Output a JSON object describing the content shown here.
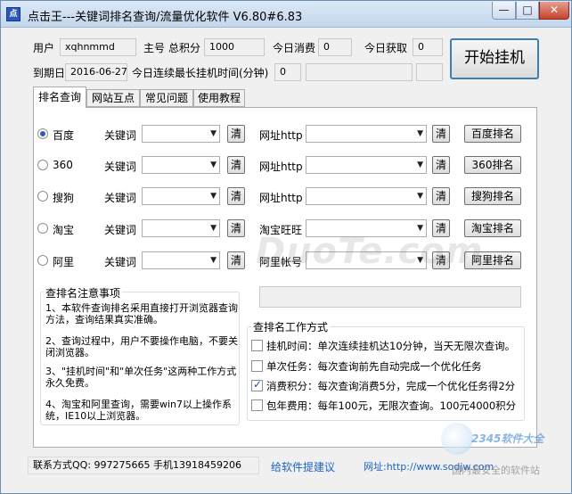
{
  "window": {
    "title": "点击王---关键词排名查询/流量优化软件  V6.80#6.83",
    "icon": "app-icon",
    "controls": {
      "minimize": "—",
      "maximize": "□",
      "close": "✕"
    }
  },
  "account": {
    "user_label": "用户",
    "user_value": "xqhnmmd",
    "main_label": "主号",
    "points_label": "总积分",
    "points_value": "1000",
    "today_spend_label": "今日消费",
    "today_spend_value": "0",
    "today_gain_label": "今日获取",
    "today_gain_value": "0",
    "expiry_label": "到期日",
    "expiry_value": "2016-06-27",
    "longest_label": "今日连续最长挂机时间(分钟)",
    "longest_value": "0",
    "start_button": "开始挂机"
  },
  "tabs": [
    "排名查询",
    "网站互点",
    "常见问题",
    "使用教程"
  ],
  "engines": [
    {
      "name": "百度",
      "selected": true,
      "keyword_label": "关键词",
      "clear1": "清",
      "url_label": "网址http",
      "clear2": "清",
      "button": "百度排名"
    },
    {
      "name": "360",
      "selected": false,
      "keyword_label": "关键词",
      "clear1": "清",
      "url_label": "网址http",
      "clear2": "清",
      "button": "360排名"
    },
    {
      "name": "搜狗",
      "selected": false,
      "keyword_label": "关键词",
      "clear1": "清",
      "url_label": "网址http",
      "clear2": "清",
      "button": "搜狗排名"
    },
    {
      "name": "淘宝",
      "selected": false,
      "keyword_label": "关键词",
      "clear1": "清",
      "url_label": "淘宝旺旺",
      "clear2": "清",
      "button": "淘宝排名"
    },
    {
      "name": "阿里",
      "selected": false,
      "keyword_label": "关键词",
      "clear1": "清",
      "url_label": "阿里帐号",
      "clear2": "清",
      "button": "阿里排名"
    }
  ],
  "notes": {
    "title": "查排名注意事项",
    "items": [
      "1、本软件查询排名采用直接打开浏览器查询方法，查询结果真实准确。",
      "2、查询过程中，用户不要操作电脑，不要关闭浏览器。",
      "3、\"挂机时间\"和\"单次任务\"这两种工作方式永久免费。",
      "4、淘宝和阿里查询，需要win7以上操作系统，IE10以上浏览器。"
    ]
  },
  "modes": {
    "title": "查排名工作方式",
    "items": [
      {
        "label": "挂机时间：单次连续挂机达10分钟，当天无限次查询。",
        "checked": false
      },
      {
        "label": "单次任务：每次查询前先自动完成一个优化任务",
        "checked": false
      },
      {
        "label": "消费积分：每次查询消费5分，完成一个优化任务得2分",
        "checked": true
      },
      {
        "label": "包年费用：每年100元，无限次查询。100元4000积分",
        "checked": false
      }
    ]
  },
  "footer": {
    "contact": "联系方式QQ: 997275665    手机13918459206",
    "suggest": "给软件提建议",
    "website": "网址:http://www.sodjw.com"
  },
  "watermarks": {
    "duote": "DuoTe.com",
    "site2345": "2345软件大全",
    "trusted": "国内最安全的软件站"
  }
}
